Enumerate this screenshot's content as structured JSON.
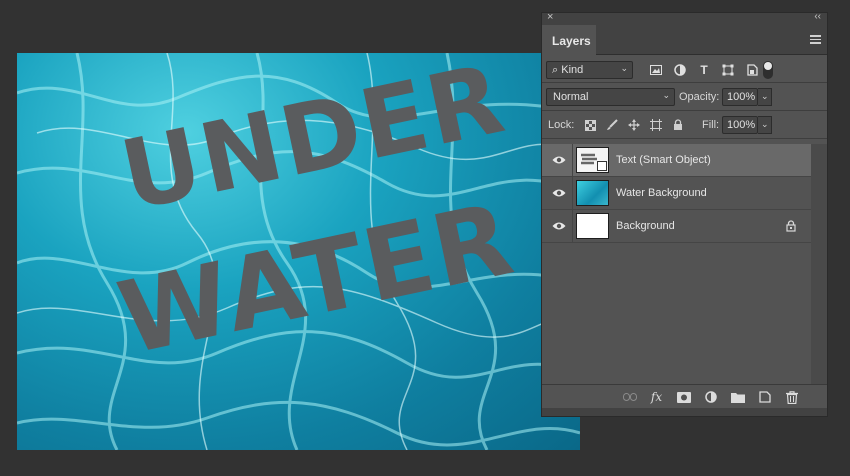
{
  "canvas": {
    "text_line1": "UNDER",
    "text_line2": "WATER"
  },
  "panel": {
    "close_glyph": "×",
    "collapse_glyph": "‹‹",
    "tab_label": "Layers",
    "filter": {
      "kind_label": "Kind",
      "icons": [
        "image-filter-icon",
        "adjustment-filter-icon",
        "type-filter-icon",
        "shape-filter-icon",
        "smart-object-filter-icon"
      ]
    },
    "blend_mode": "Normal",
    "opacity_label": "Opacity:",
    "opacity_value": "100%",
    "lock_label": "Lock:",
    "fill_label": "Fill:",
    "fill_value": "100%",
    "layers": [
      {
        "name": "Text (Smart Object)",
        "selected": true,
        "thumb": "text"
      },
      {
        "name": "Water Background",
        "selected": false,
        "thumb": "water"
      },
      {
        "name": "Background",
        "selected": false,
        "thumb": "white",
        "locked": true
      }
    ],
    "bottom_icons": [
      "link-icon",
      "fx-icon",
      "mask-icon",
      "adjustment-icon",
      "folder-icon",
      "new-layer-icon",
      "trash-icon"
    ],
    "fx_label": "fx"
  },
  "colors": {
    "app_bg": "#323232",
    "panel_bg": "#535353",
    "selected_row": "#696969",
    "text_fill": "#5a5c5e"
  }
}
